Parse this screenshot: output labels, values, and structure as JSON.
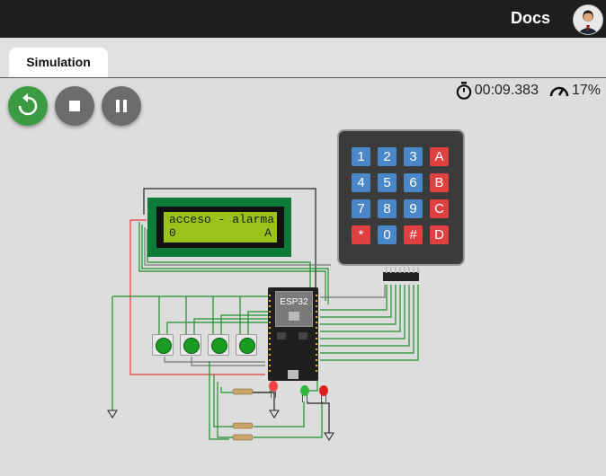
{
  "header": {
    "docs_label": "Docs",
    "avatar_icon": "user-avatar"
  },
  "tabs": [
    {
      "label": "Simulation",
      "active": true
    }
  ],
  "controls": {
    "restart_icon": "restart-icon",
    "stop_icon": "stop-icon",
    "pause_icon": "pause-icon",
    "restart_color": "#3a9b42",
    "secondary_color": "#6c6c6c"
  },
  "stats": {
    "time_icon": "stopwatch-icon",
    "time": "00:09.383",
    "speed_icon": "speedometer-icon",
    "speed": "17%"
  },
  "lcd": {
    "line1": "acceso - alarma",
    "line2_left": "0",
    "line2_right": "A",
    "board_color": "#0d7a3a",
    "screen_color": "#9ac21a"
  },
  "keypad": {
    "rows": [
      [
        "1",
        "2",
        "3",
        "A"
      ],
      [
        "4",
        "5",
        "6",
        "B"
      ],
      [
        "7",
        "8",
        "9",
        "C"
      ],
      [
        "*",
        "0",
        "#",
        "D"
      ]
    ],
    "number_key_color": "#4a87c9",
    "letter_key_color": "#e04040"
  },
  "board": {
    "label": "ESP32"
  },
  "wire_colors": {
    "green": "#1f8f2a",
    "red": "#e23b3b",
    "black": "#222222",
    "gray": "#777777"
  }
}
